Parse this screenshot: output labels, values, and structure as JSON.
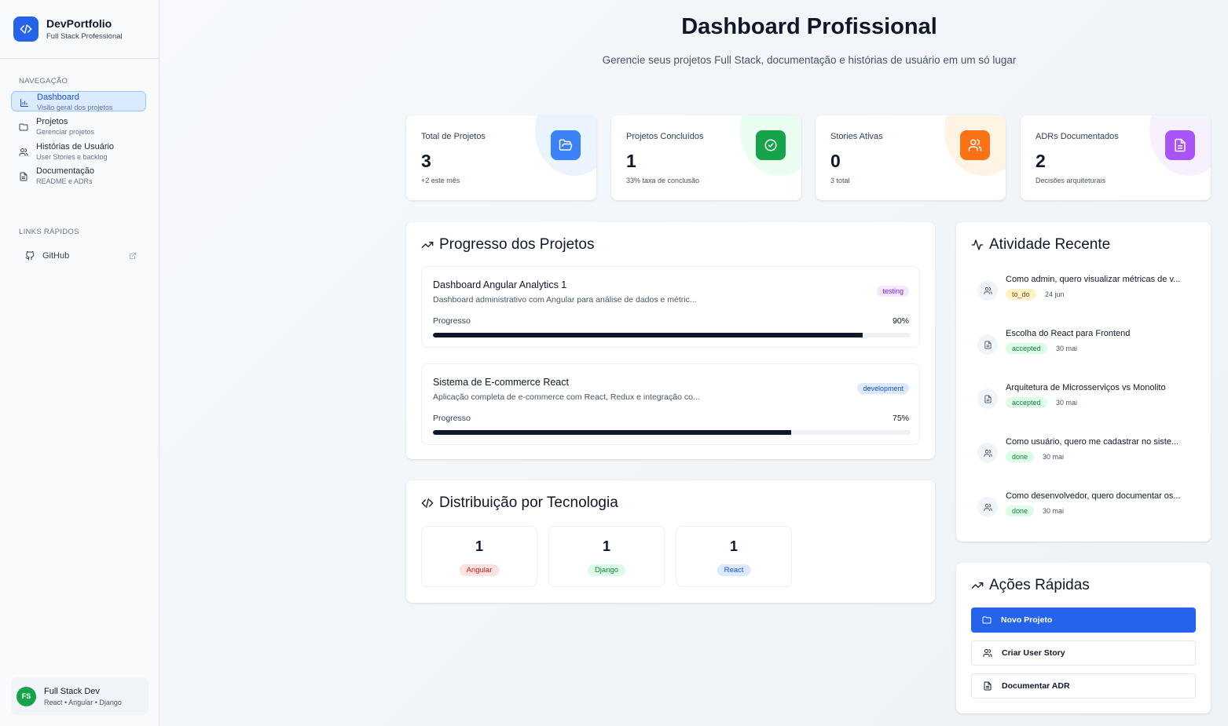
{
  "brand": {
    "name": "DevPortfolio",
    "subtitle": "Full Stack Professional"
  },
  "sidebar": {
    "nav_label": "NAVEGAÇÃO",
    "items": [
      {
        "title": "Dashboard",
        "subtitle": "Visão geral dos projetos",
        "icon": "bar-chart-icon",
        "active": true
      },
      {
        "title": "Projetos",
        "subtitle": "Gerenciar projetos",
        "icon": "folder-icon"
      },
      {
        "title": "Histórias de Usuário",
        "subtitle": "User Stories e backlog",
        "icon": "users-icon"
      },
      {
        "title": "Documentação",
        "subtitle": "README e ADRs",
        "icon": "file-text-icon"
      }
    ],
    "quick_label": "LINKS RÁPIDOS",
    "quick_links": [
      {
        "label": "GitHub",
        "icon": "github-icon",
        "external_icon": "external-link-icon"
      }
    ],
    "user": {
      "initials": "FS",
      "name": "Full Stack Dev",
      "stack": "React • Angular • Django"
    }
  },
  "header": {
    "title": "Dashboard Profissional",
    "subtitle": "Gerencie seus projetos Full Stack, documentação e histórias de usuário em um só lugar"
  },
  "stats": [
    {
      "label": "Total de Projetos",
      "value": "3",
      "note": "+2 este mês",
      "icon": "folder-open-icon",
      "color": "#3b82f6"
    },
    {
      "label": "Projetos Concluídos",
      "value": "1",
      "note": "33% taxa de conclusão",
      "icon": "check-circle-icon",
      "color": "#16a34a"
    },
    {
      "label": "Stories Ativas",
      "value": "0",
      "note": "3 total",
      "icon": "users-icon",
      "color": "#f97316"
    },
    {
      "label": "ADRs Documentados",
      "value": "2",
      "note": "Decisões arquiteturais",
      "icon": "file-text-icon",
      "color": "#a855f7"
    }
  ],
  "progress_panel": {
    "title": "Progresso dos Projetos",
    "progress_label": "Progresso",
    "projects": [
      {
        "name": "Dashboard Angular Analytics 1",
        "description": "Dashboard administrativo com Angular para análise de dados e métric...",
        "status": "testing",
        "progress": 90,
        "progress_text": "90%"
      },
      {
        "name": "Sistema de E-commerce React",
        "description": "Aplicação completa de e-commerce com React, Redux e integração co...",
        "status": "development",
        "progress": 75,
        "progress_text": "75%"
      }
    ]
  },
  "tech_panel": {
    "title": "Distribuição por Tecnologia",
    "items": [
      {
        "count": "1",
        "name": "Angular"
      },
      {
        "count": "1",
        "name": "Django"
      },
      {
        "count": "1",
        "name": "React"
      }
    ]
  },
  "activity_panel": {
    "title": "Atividade Recente",
    "items": [
      {
        "title": "Como admin, quero visualizar métricas de v...",
        "status": "to_do",
        "date": "24 jun",
        "icon": "users-icon"
      },
      {
        "title": "Escolha do React para Frontend",
        "status": "accepted",
        "date": "30 mai",
        "icon": "file-text-icon"
      },
      {
        "title": "Arquitetura de Microsserviços vs Monolito",
        "status": "accepted",
        "date": "30 mai",
        "icon": "file-text-icon"
      },
      {
        "title": "Como usuário, quero me cadastrar no siste...",
        "status": "done",
        "date": "30 mai",
        "icon": "users-icon"
      },
      {
        "title": "Como desenvolvedor, quero documentar os...",
        "status": "done",
        "date": "30 mai",
        "icon": "users-icon"
      }
    ]
  },
  "quick_actions": {
    "title": "Ações Rápidas",
    "buttons": [
      {
        "label": "Novo Projeto",
        "icon": "folder-icon",
        "primary": true
      },
      {
        "label": "Criar User Story",
        "icon": "users-icon"
      },
      {
        "label": "Documentar ADR",
        "icon": "file-text-icon"
      }
    ]
  },
  "colors": {
    "accent": "#2563eb",
    "primary_text": "#0f172a",
    "muted": "#475569"
  }
}
